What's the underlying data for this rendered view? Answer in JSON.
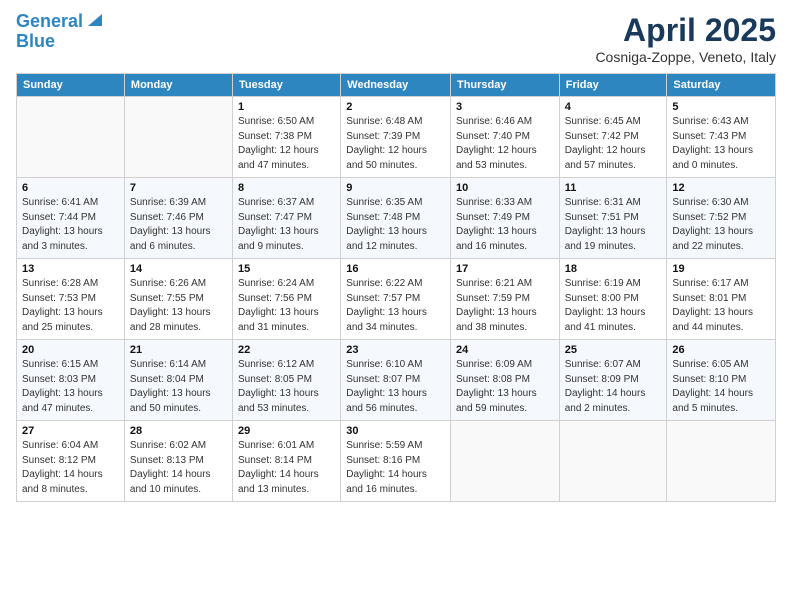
{
  "header": {
    "logo_line1": "General",
    "logo_line2": "Blue",
    "title": "April 2025",
    "subtitle": "Cosniga-Zoppe, Veneto, Italy"
  },
  "calendar": {
    "columns": [
      "Sunday",
      "Monday",
      "Tuesday",
      "Wednesday",
      "Thursday",
      "Friday",
      "Saturday"
    ],
    "weeks": [
      [
        {
          "day": "",
          "info": ""
        },
        {
          "day": "",
          "info": ""
        },
        {
          "day": "1",
          "info": "Sunrise: 6:50 AM\nSunset: 7:38 PM\nDaylight: 12 hours and 47 minutes."
        },
        {
          "day": "2",
          "info": "Sunrise: 6:48 AM\nSunset: 7:39 PM\nDaylight: 12 hours and 50 minutes."
        },
        {
          "day": "3",
          "info": "Sunrise: 6:46 AM\nSunset: 7:40 PM\nDaylight: 12 hours and 53 minutes."
        },
        {
          "day": "4",
          "info": "Sunrise: 6:45 AM\nSunset: 7:42 PM\nDaylight: 12 hours and 57 minutes."
        },
        {
          "day": "5",
          "info": "Sunrise: 6:43 AM\nSunset: 7:43 PM\nDaylight: 13 hours and 0 minutes."
        }
      ],
      [
        {
          "day": "6",
          "info": "Sunrise: 6:41 AM\nSunset: 7:44 PM\nDaylight: 13 hours and 3 minutes."
        },
        {
          "day": "7",
          "info": "Sunrise: 6:39 AM\nSunset: 7:46 PM\nDaylight: 13 hours and 6 minutes."
        },
        {
          "day": "8",
          "info": "Sunrise: 6:37 AM\nSunset: 7:47 PM\nDaylight: 13 hours and 9 minutes."
        },
        {
          "day": "9",
          "info": "Sunrise: 6:35 AM\nSunset: 7:48 PM\nDaylight: 13 hours and 12 minutes."
        },
        {
          "day": "10",
          "info": "Sunrise: 6:33 AM\nSunset: 7:49 PM\nDaylight: 13 hours and 16 minutes."
        },
        {
          "day": "11",
          "info": "Sunrise: 6:31 AM\nSunset: 7:51 PM\nDaylight: 13 hours and 19 minutes."
        },
        {
          "day": "12",
          "info": "Sunrise: 6:30 AM\nSunset: 7:52 PM\nDaylight: 13 hours and 22 minutes."
        }
      ],
      [
        {
          "day": "13",
          "info": "Sunrise: 6:28 AM\nSunset: 7:53 PM\nDaylight: 13 hours and 25 minutes."
        },
        {
          "day": "14",
          "info": "Sunrise: 6:26 AM\nSunset: 7:55 PM\nDaylight: 13 hours and 28 minutes."
        },
        {
          "day": "15",
          "info": "Sunrise: 6:24 AM\nSunset: 7:56 PM\nDaylight: 13 hours and 31 minutes."
        },
        {
          "day": "16",
          "info": "Sunrise: 6:22 AM\nSunset: 7:57 PM\nDaylight: 13 hours and 34 minutes."
        },
        {
          "day": "17",
          "info": "Sunrise: 6:21 AM\nSunset: 7:59 PM\nDaylight: 13 hours and 38 minutes."
        },
        {
          "day": "18",
          "info": "Sunrise: 6:19 AM\nSunset: 8:00 PM\nDaylight: 13 hours and 41 minutes."
        },
        {
          "day": "19",
          "info": "Sunrise: 6:17 AM\nSunset: 8:01 PM\nDaylight: 13 hours and 44 minutes."
        }
      ],
      [
        {
          "day": "20",
          "info": "Sunrise: 6:15 AM\nSunset: 8:03 PM\nDaylight: 13 hours and 47 minutes."
        },
        {
          "day": "21",
          "info": "Sunrise: 6:14 AM\nSunset: 8:04 PM\nDaylight: 13 hours and 50 minutes."
        },
        {
          "day": "22",
          "info": "Sunrise: 6:12 AM\nSunset: 8:05 PM\nDaylight: 13 hours and 53 minutes."
        },
        {
          "day": "23",
          "info": "Sunrise: 6:10 AM\nSunset: 8:07 PM\nDaylight: 13 hours and 56 minutes."
        },
        {
          "day": "24",
          "info": "Sunrise: 6:09 AM\nSunset: 8:08 PM\nDaylight: 13 hours and 59 minutes."
        },
        {
          "day": "25",
          "info": "Sunrise: 6:07 AM\nSunset: 8:09 PM\nDaylight: 14 hours and 2 minutes."
        },
        {
          "day": "26",
          "info": "Sunrise: 6:05 AM\nSunset: 8:10 PM\nDaylight: 14 hours and 5 minutes."
        }
      ],
      [
        {
          "day": "27",
          "info": "Sunrise: 6:04 AM\nSunset: 8:12 PM\nDaylight: 14 hours and 8 minutes."
        },
        {
          "day": "28",
          "info": "Sunrise: 6:02 AM\nSunset: 8:13 PM\nDaylight: 14 hours and 10 minutes."
        },
        {
          "day": "29",
          "info": "Sunrise: 6:01 AM\nSunset: 8:14 PM\nDaylight: 14 hours and 13 minutes."
        },
        {
          "day": "30",
          "info": "Sunrise: 5:59 AM\nSunset: 8:16 PM\nDaylight: 14 hours and 16 minutes."
        },
        {
          "day": "",
          "info": ""
        },
        {
          "day": "",
          "info": ""
        },
        {
          "day": "",
          "info": ""
        }
      ]
    ]
  }
}
